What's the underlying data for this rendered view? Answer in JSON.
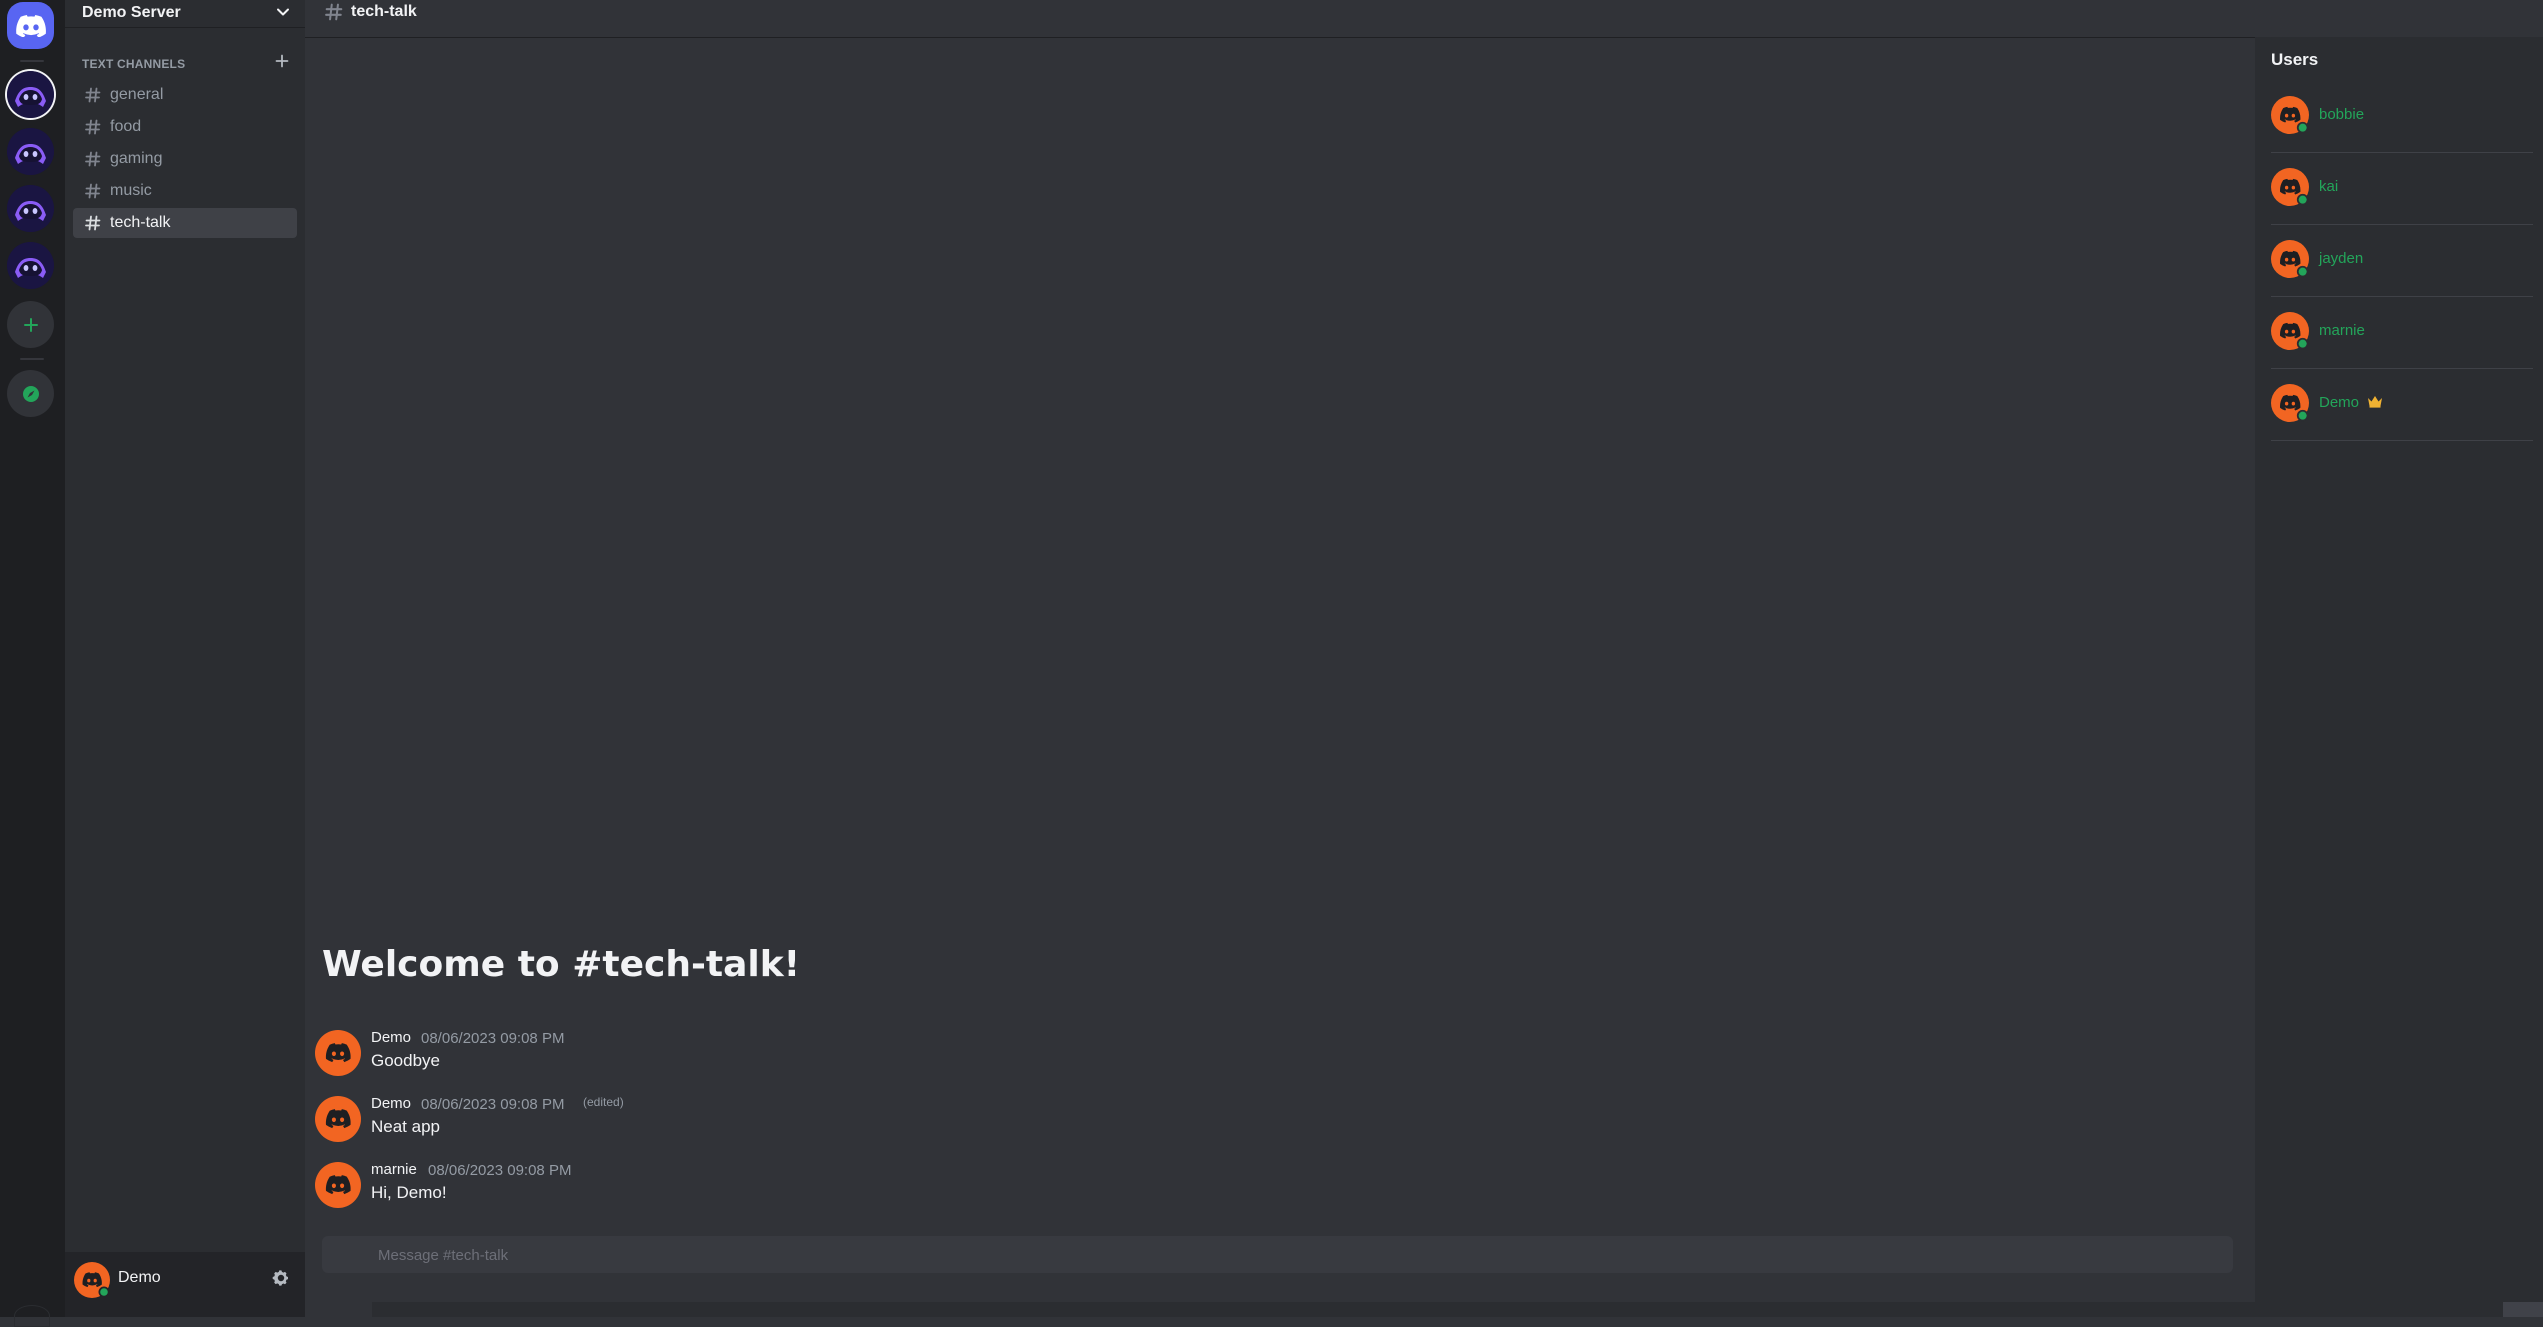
{
  "server": {
    "name": "Demo Server",
    "category_label": "TEXT CHANNELS",
    "channels": [
      {
        "name": "general"
      },
      {
        "name": "food"
      },
      {
        "name": "gaming"
      },
      {
        "name": "music"
      },
      {
        "name": "tech-talk",
        "active": true
      }
    ]
  },
  "rail": {
    "home_icon": "discord-logo-icon",
    "servers": [
      "server-icon",
      "server-icon",
      "server-icon",
      "server-icon"
    ],
    "add_icon": "plus-icon",
    "explore_icon": "compass-icon"
  },
  "current_user": {
    "name": "Demo",
    "status": "online",
    "settings_icon": "gear-icon"
  },
  "chat": {
    "channel_name": "tech-talk",
    "welcome": "Welcome to #tech-talk!",
    "messages": [
      {
        "author": "Demo",
        "timestamp": "08/06/2023 09:08 PM",
        "text": "Goodbye",
        "edited": ""
      },
      {
        "author": "Demo",
        "timestamp": "08/06/2023 09:08 PM",
        "text": "Neat app",
        "edited": "(edited)"
      },
      {
        "author": "marnie",
        "timestamp": "08/06/2023 09:08 PM",
        "text": "Hi, Demo!",
        "edited": ""
      }
    ],
    "composer_placeholder": "Message #tech-talk"
  },
  "members": {
    "title": "Users",
    "list": [
      {
        "name": "bobbie",
        "status": "online"
      },
      {
        "name": "kai",
        "status": "online"
      },
      {
        "name": "jayden",
        "status": "online"
      },
      {
        "name": "marnie",
        "status": "online"
      },
      {
        "name": "Demo",
        "status": "online",
        "owner": true,
        "owner_icon": "crown-icon"
      }
    ]
  },
  "colors": {
    "accent": "#5865f2",
    "online": "#23a55a",
    "avatar": "#f26522",
    "crown": "#f0b232",
    "server_icon": "#8a5cf6"
  }
}
